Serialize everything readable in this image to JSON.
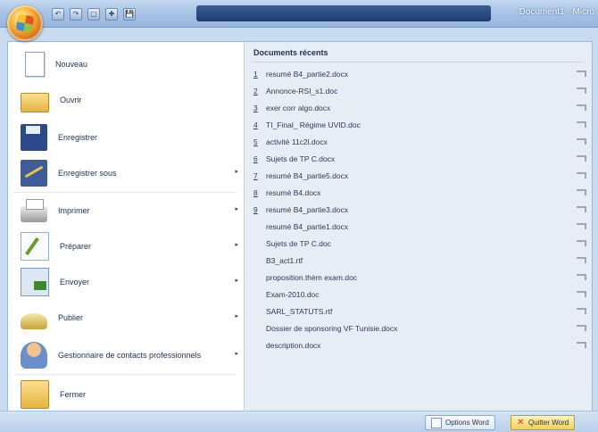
{
  "window": {
    "title": "Document1 - Micro"
  },
  "quick_access": [
    "↶",
    "↷",
    "▢",
    "✚",
    "💾"
  ],
  "office_menu": {
    "commands": [
      {
        "id": "nouveau",
        "label": "Nouveau",
        "has_submenu": false,
        "icon": "new-document-icon"
      },
      {
        "id": "ouvrir",
        "label": "Ouvrir",
        "has_submenu": false,
        "icon": "folder-open-icon"
      },
      {
        "id": "enregistrer",
        "label": "Enregistrer",
        "has_submenu": false,
        "icon": "save-icon"
      },
      {
        "id": "enregistrer-sous",
        "label": "Enregistrer sous",
        "has_submenu": true,
        "icon": "save-as-icon"
      },
      {
        "id": "imprimer",
        "label": "Imprimer",
        "has_submenu": true,
        "icon": "printer-icon"
      },
      {
        "id": "preparer",
        "label": "Préparer",
        "has_submenu": true,
        "icon": "prepare-icon"
      },
      {
        "id": "envoyer",
        "label": "Envoyer",
        "has_submenu": true,
        "icon": "send-icon"
      },
      {
        "id": "publier",
        "label": "Publier",
        "has_submenu": true,
        "icon": "publish-icon"
      },
      {
        "id": "gestionnaire",
        "label": "Gestionnaire de contacts professionnels",
        "has_submenu": true,
        "icon": "contacts-icon"
      },
      {
        "id": "fermer",
        "label": "Fermer",
        "has_submenu": false,
        "icon": "close-folder-icon"
      }
    ],
    "submenu_arrow": "▸"
  },
  "recent": {
    "title": "Documents récents",
    "items": [
      {
        "num": "1",
        "name": "resumé B4_partie2.docx"
      },
      {
        "num": "2",
        "name": "Annonce-RSI_s1.doc"
      },
      {
        "num": "3",
        "name": "exer corr algo.docx"
      },
      {
        "num": "4",
        "name": "TI_Final_ Régime UVID.doc"
      },
      {
        "num": "5",
        "name": "activité 11c2l.docx"
      },
      {
        "num": "6",
        "name": "Sujets de TP C.docx"
      },
      {
        "num": "7",
        "name": "resumé B4_partie5.docx"
      },
      {
        "num": "8",
        "name": "resumé B4.docx"
      },
      {
        "num": "9",
        "name": "resumé B4_partie3.docx"
      },
      {
        "num": "",
        "name": "resumé B4_partie1.docx"
      },
      {
        "num": "",
        "name": "Sujets de TP C.doc"
      },
      {
        "num": "",
        "name": "B3_act1.rtf"
      },
      {
        "num": "",
        "name": "proposition.thèm exam.doc"
      },
      {
        "num": "",
        "name": "Exam-2010.doc"
      },
      {
        "num": "",
        "name": "SARL_STATUTS.rtf"
      },
      {
        "num": "",
        "name": "Dossier de sponsoring VF Tunisie.docx"
      },
      {
        "num": "",
        "name": "description.docx"
      }
    ]
  },
  "buttons": {
    "options_label": "Options Word",
    "quit_label": "Quitter Word",
    "quit_icon": "✕"
  }
}
